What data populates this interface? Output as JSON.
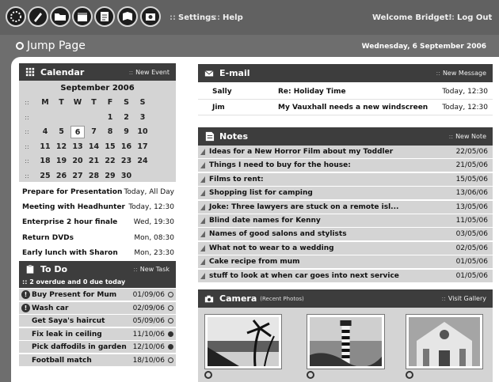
{
  "toolbar": {
    "icons": [
      "home-icon",
      "pen-icon",
      "folder-icon",
      "calendar-icon",
      "notes-icon",
      "book-icon",
      "photo-icon"
    ],
    "settings_label": "Settings",
    "help_label": "Help",
    "welcome": "Welcome Bridget!",
    "logout_label": "Log Out"
  },
  "header": {
    "title": "Jump Page",
    "date": "Wednesday, 6 September 2006"
  },
  "calendar": {
    "title": "Calendar",
    "action": "New Event",
    "month": "September 2006",
    "weekdays": [
      "M",
      "T",
      "W",
      "T",
      "F",
      "S",
      "S"
    ],
    "weeks": [
      [
        "",
        "",
        "",
        "",
        "1",
        "2",
        "3"
      ],
      [
        "4",
        "5",
        "6",
        "7",
        "8",
        "9",
        "10"
      ],
      [
        "11",
        "12",
        "13",
        "14",
        "15",
        "16",
        "17"
      ],
      [
        "18",
        "19",
        "20",
        "21",
        "22",
        "23",
        "24"
      ],
      [
        "25",
        "26",
        "27",
        "28",
        "29",
        "30",
        ""
      ]
    ],
    "today": "6"
  },
  "events": [
    {
      "name": "Prepare for Presentation",
      "time": "Today, All Day"
    },
    {
      "name": "Meeting with Headhunter",
      "time": "Today, 12:30"
    },
    {
      "name": "Enterprise 2 hour finale",
      "time": "Wed, 19:30"
    },
    {
      "name": "Return DVDs",
      "time": "Mon, 08:30"
    },
    {
      "name": "Early lunch with Sharon",
      "time": "Mon, 23:30"
    }
  ],
  "todo": {
    "title": "To Do",
    "action": "New Task",
    "summary": "2 overdue and  0 due today",
    "items": [
      {
        "name": "Buy Present for Mum",
        "date": "01/09/06",
        "overdue": true,
        "done": false
      },
      {
        "name": "Wash car",
        "date": "02/09/06",
        "overdue": true,
        "done": false
      },
      {
        "name": "Get Saya's haircut",
        "date": "05/09/06",
        "overdue": false,
        "done": false
      },
      {
        "name": "Fix leak in ceiling",
        "date": "11/10/06",
        "overdue": false,
        "done": true
      },
      {
        "name": "Pick daffodils in garden",
        "date": "12/10/06",
        "overdue": false,
        "done": true
      },
      {
        "name": "Football match",
        "date": "18/10/06",
        "overdue": false,
        "done": false
      }
    ]
  },
  "email": {
    "title": "E-mail",
    "action": "New Message",
    "messages": [
      {
        "from": "Sally",
        "subject": "Re: Holiday Time",
        "time": "Today, 12:30"
      },
      {
        "from": "Jim",
        "subject": "My Vauxhall needs a new windscreen",
        "time": "Today, 12:30"
      }
    ]
  },
  "notes": {
    "title": "Notes",
    "action": "New Note",
    "items": [
      {
        "name": "Ideas for a New Horror Film about my Toddler",
        "date": "22/05/06"
      },
      {
        "name": "Things I need to buy for the house:",
        "date": "21/05/06"
      },
      {
        "name": "Films to rent:",
        "date": "15/05/06"
      },
      {
        "name": "Shopping list for camping",
        "date": "13/06/06"
      },
      {
        "name": "Joke: Three lawyers are stuck on a remote isl...",
        "date": "13/05/06"
      },
      {
        "name": "Blind date names for Kenny",
        "date": "11/05/06"
      },
      {
        "name": "Names of good salons and stylists",
        "date": "03/05/06"
      },
      {
        "name": "What not to wear to a wedding",
        "date": "02/05/06"
      },
      {
        "name": "Cake recipe from mum",
        "date": "01/05/06"
      },
      {
        "name": "stuff to look at when car goes into next service",
        "date": "01/05/06"
      }
    ]
  },
  "camera": {
    "title": "Camera",
    "subtitle": "(Recent Photos)",
    "action": "Visit Gallery",
    "photos": [
      "palm-beach-photo",
      "lighthouse-photo",
      "cathedral-photo"
    ]
  }
}
